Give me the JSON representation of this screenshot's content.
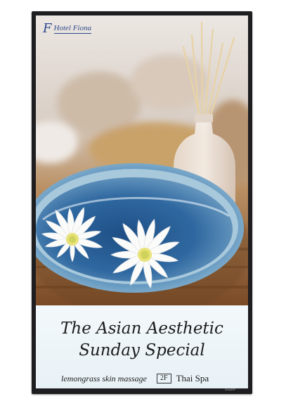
{
  "signage": {
    "logo_monogram": "F",
    "hotel_name": "Hotel Fiona",
    "headline_line1": "The Asian Aesthetic",
    "headline_line2": "Sunday Special",
    "service": "lemongrass skin massage",
    "floor": "2F",
    "location": "Thai Spa",
    "display_brand": "SHARP"
  },
  "colors": {
    "bezel": "#1e1e20",
    "logo_blue": "#2e4a8e",
    "caption_background": "#eef5f9",
    "bowl_blue": "#4d87b5",
    "headline_text": "#1c1c1c"
  },
  "icons": [
    "hotel-monogram-logo"
  ]
}
